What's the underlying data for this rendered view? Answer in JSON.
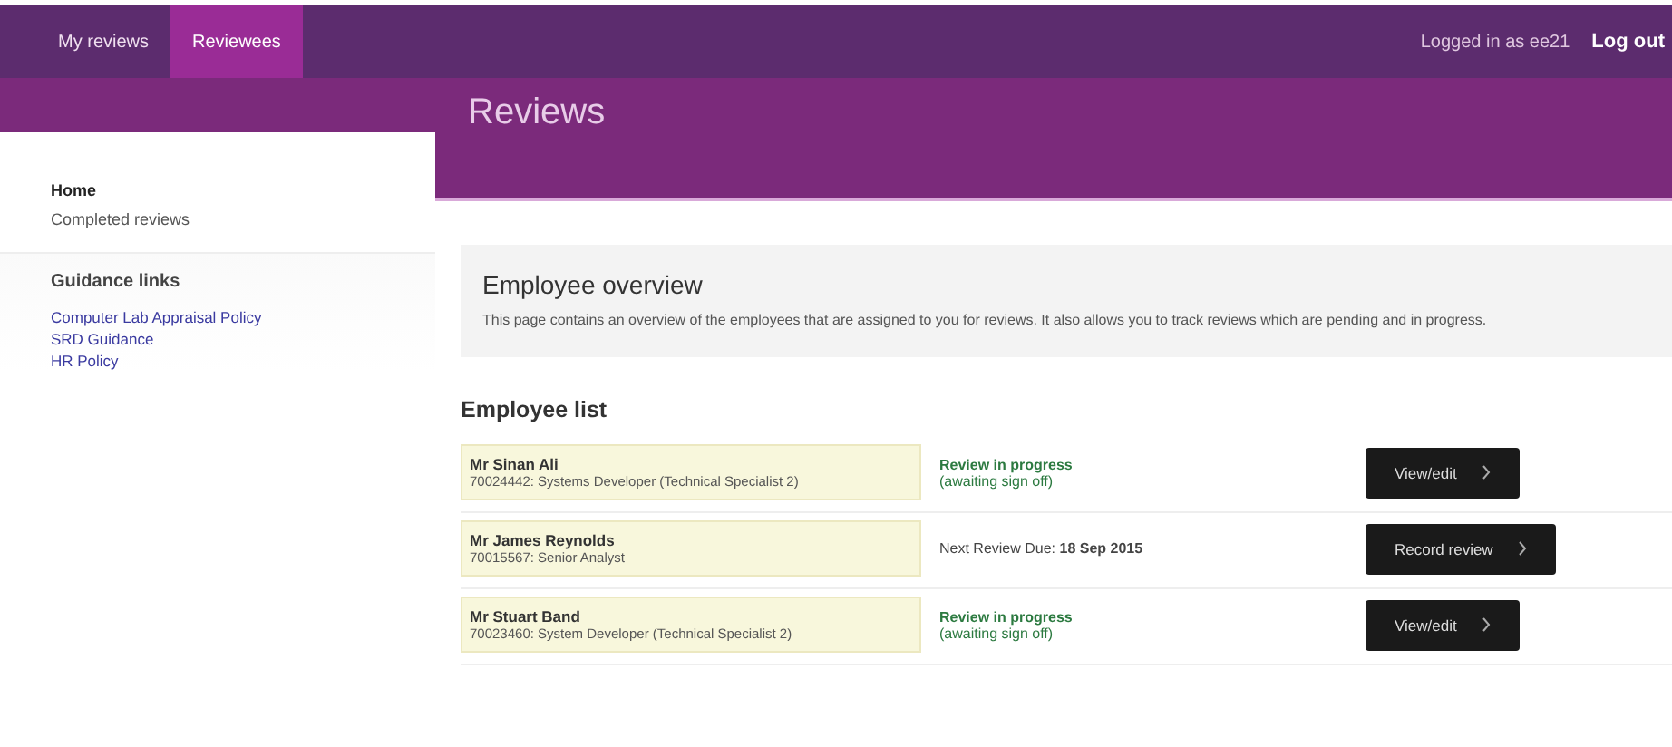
{
  "top_nav": {
    "tabs": [
      {
        "label": "My reviews",
        "selected": false
      },
      {
        "label": "Reviewees",
        "selected": true
      }
    ],
    "user": "Logged in as ee21",
    "logout": "Log out"
  },
  "sidebar": {
    "items": [
      {
        "label": "Home",
        "selected": true
      },
      {
        "label": "Completed reviews",
        "selected": false
      }
    ],
    "links_heading": "Guidance links",
    "links": [
      "Computer Lab Appraisal Policy",
      "SRD Guidance",
      "HR Policy"
    ]
  },
  "page_title": "Reviews",
  "overview": {
    "title": "Employee overview",
    "text": "This page contains an overview of the employees that are assigned to you for reviews. It also allows you to track reviews which are pending and in progress."
  },
  "employee_list": {
    "title": "Employee list",
    "rows": [
      {
        "name": "Mr Sinan Ali",
        "details": "70024442: Systems Developer (Technical Specialist 2)",
        "kind": "in_progress",
        "status": "Review in progress",
        "status_note": "(awaiting sign off)",
        "action": "View/edit"
      },
      {
        "name": "Mr James Reynolds",
        "details": "70015567: Senior Analyst",
        "kind": "due",
        "status": "Next Review Due: **18 Sep 2015**",
        "action": "Record review"
      },
      {
        "name": "Mr Stuart Band",
        "details": "70023460: System Developer (Technical Specialist 2)",
        "kind": "in_progress",
        "status": "Review in progress",
        "status_note": "(awaiting sign off)",
        "action": "View/edit"
      }
    ]
  }
}
